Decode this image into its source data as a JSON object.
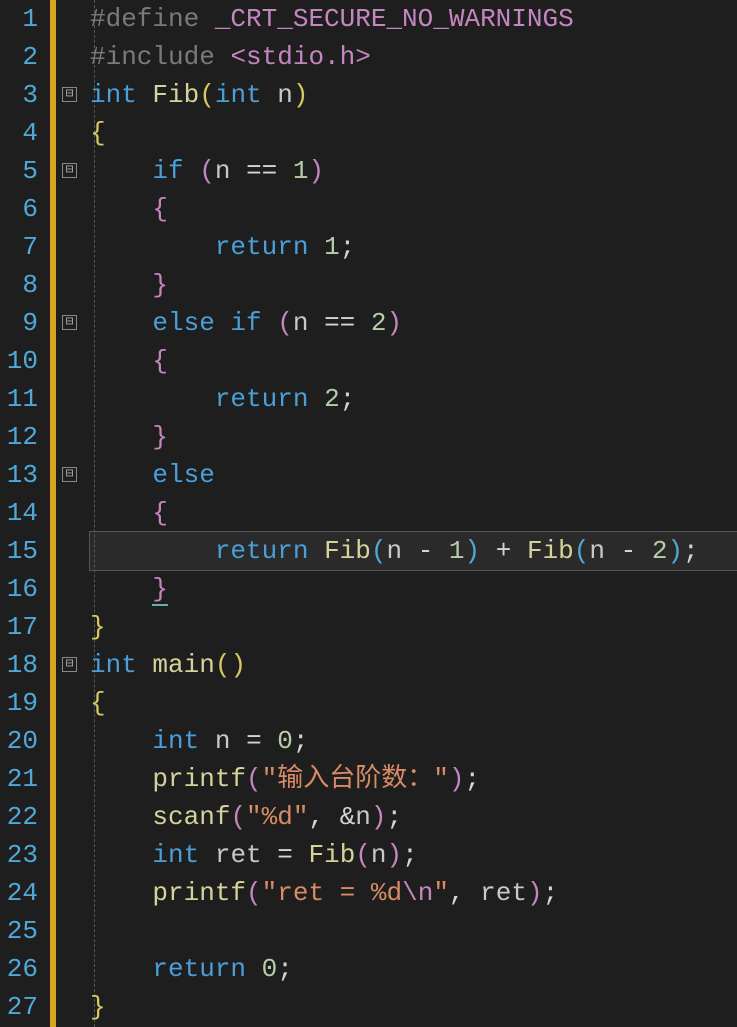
{
  "gutter": {
    "lines": [
      "1",
      "2",
      "3",
      "4",
      "5",
      "6",
      "7",
      "8",
      "9",
      "10",
      "11",
      "12",
      "13",
      "14",
      "15",
      "16",
      "17",
      "18",
      "19",
      "20",
      "21",
      "22",
      "23",
      "24",
      "25",
      "26",
      "27"
    ]
  },
  "fold": {
    "minus": "⊟"
  },
  "tok": {
    "define": "#define ",
    "macro": "_CRT_SECURE_NO_WARNINGS",
    "include": "#include ",
    "lt": "<",
    "header": "stdio.h",
    "gt": ">",
    "int": "int",
    "Fib": "Fib",
    "lp": "(",
    "rp": ")",
    "n": "n",
    "lb": "{",
    "rb": "}",
    "if": "if",
    "eqeq": "==",
    "one": "1",
    "two": "2",
    "zero": "0",
    "return": "return",
    "semi": ";",
    "else": "else",
    "elseif": "else if",
    "minus": "-",
    "plus": "+",
    "main": "main",
    "eq": "=",
    "printf": "printf",
    "scanf": "scanf",
    "str_prompt": "\"输入台阶数：\"",
    "str_fmt": "\"%d\"",
    "amp": "&",
    "comma": ",",
    "ret": "ret",
    "str_ret_open": "\"ret = %d",
    "esc_n": "\\n",
    "str_ret_close": "\""
  }
}
